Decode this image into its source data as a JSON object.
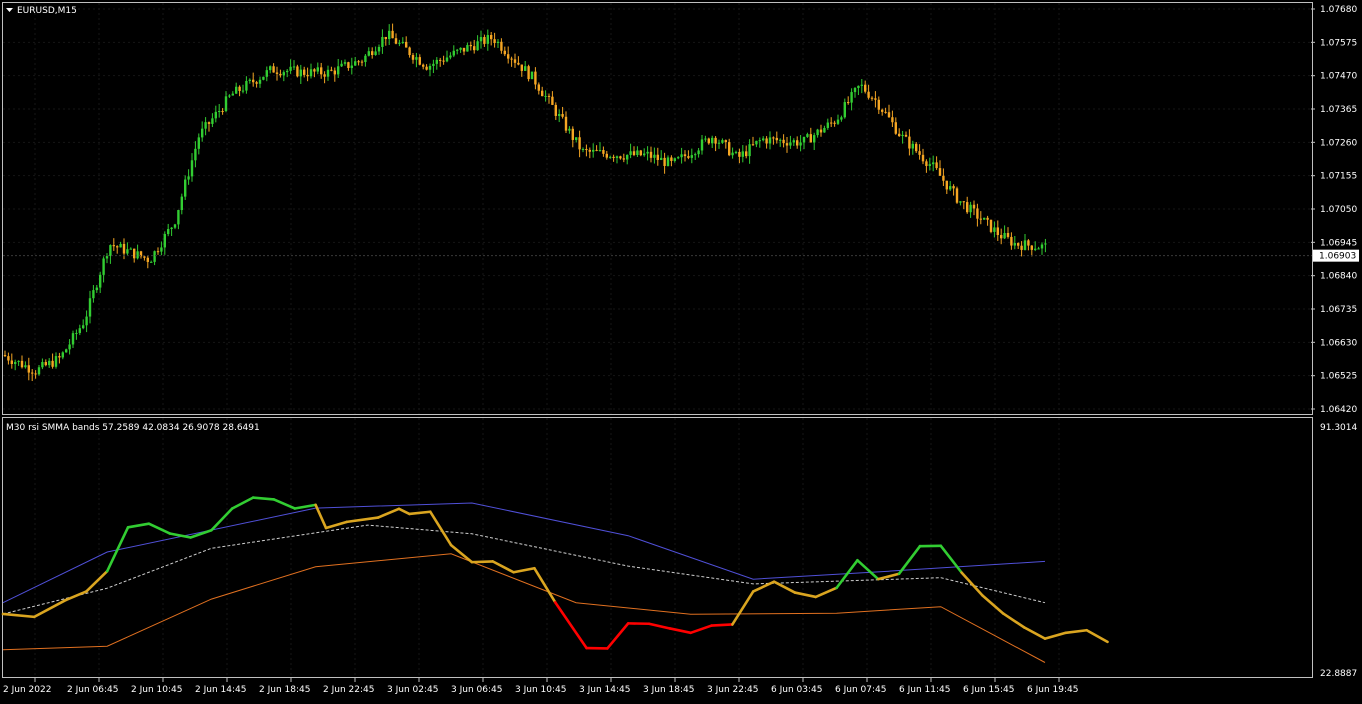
{
  "main_pane": {
    "title": "EURUSD,M15",
    "current_price": "1.06903",
    "price_ticks": [
      "1.07680",
      "1.07575",
      "1.07470",
      "1.07365",
      "1.07260",
      "1.07155",
      "1.07050",
      "1.06945",
      "1.06840",
      "1.06735",
      "1.06630",
      "1.06525",
      "1.06420"
    ]
  },
  "indicator_pane": {
    "title": "M30 rsi SMMA bands 57.2589 42.0834 26.9078 28.6491",
    "max_label": "91.3014",
    "min_label": "22.8887"
  },
  "time_ticks": [
    "2 Jun 2022",
    "2 Jun 06:45",
    "2 Jun 10:45",
    "2 Jun 14:45",
    "2 Jun 18:45",
    "2 Jun 22:45",
    "3 Jun 02:45",
    "3 Jun 06:45",
    "3 Jun 10:45",
    "3 Jun 14:45",
    "3 Jun 18:45",
    "3 Jun 22:45",
    "6 Jun 03:45",
    "6 Jun 07:45",
    "6 Jun 11:45",
    "6 Jun 15:45",
    "6 Jun 19:45"
  ],
  "colors": {
    "background": "#000000",
    "grid": "#161616",
    "frame": "#c0c0c0",
    "bull": "#32cd32",
    "bear": "#f5a623",
    "rsi_up": "#32cd32",
    "rsi_neutral": "#daa520",
    "rsi_down": "#ff0000",
    "band_upper": "#5050d8",
    "band_mid": "#cfcfcf",
    "band_lower": "#e07020"
  },
  "chart_data": [
    {
      "type": "candlestick",
      "symbol": "EURUSD",
      "timeframe": "M15",
      "ylim": [
        1.0642,
        1.0768
      ],
      "close_path": [
        [
          0,
          1.0659
        ],
        [
          0.04,
          1.0654
        ],
        [
          0.07,
          1.0658
        ],
        [
          0.1,
          1.067
        ],
        [
          0.13,
          1.0694
        ],
        [
          0.18,
          1.0689
        ],
        [
          0.21,
          1.0701
        ],
        [
          0.24,
          1.0728
        ],
        [
          0.28,
          1.0741
        ],
        [
          0.33,
          1.0749
        ],
        [
          0.37,
          1.0748
        ],
        [
          0.4,
          1.0748
        ],
        [
          0.44,
          1.0752
        ],
        [
          0.47,
          1.076
        ],
        [
          0.52,
          1.075
        ],
        [
          0.57,
          1.0756
        ],
        [
          0.6,
          1.0759
        ],
        [
          0.65,
          1.0746
        ],
        [
          0.71,
          1.0723
        ],
        [
          0.76,
          1.0722
        ],
        [
          0.79,
          1.0722
        ],
        [
          0.82,
          1.0719
        ],
        [
          0.87,
          1.0728
        ],
        [
          0.9,
          1.0721
        ],
        [
          0.93,
          1.0727
        ],
        [
          0.98,
          1.0726
        ],
        [
          1.02,
          1.0733
        ],
        [
          1.05,
          1.0744
        ],
        [
          1.07,
          1.0739
        ],
        [
          1.1,
          1.0728
        ],
        [
          1.14,
          1.0718
        ],
        [
          1.17,
          1.0708
        ],
        [
          1.22,
          1.0697
        ],
        [
          1.24,
          1.0694
        ],
        [
          1.28,
          1.0693
        ]
      ]
    },
    {
      "type": "line",
      "name": "M30 rsi SMMA bands",
      "ylim": [
        22.8887,
        91.3014
      ],
      "series": [
        {
          "role": "rsi",
          "values": [
            [
              0,
              38.9
            ],
            [
              0.03,
              38.1
            ],
            [
              0.06,
              42.7
            ],
            [
              0.08,
              45.1
            ],
            [
              0.1,
              50.7
            ],
            [
              0.12,
              62.8
            ],
            [
              0.14,
              63.8
            ],
            [
              0.16,
              61.1
            ],
            [
              0.18,
              60.0
            ],
            [
              0.2,
              62.0
            ],
            [
              0.22,
              68.0
            ],
            [
              0.24,
              71.0
            ],
            [
              0.26,
              70.5
            ],
            [
              0.28,
              68.0
            ],
            [
              0.3,
              69.0
            ],
            [
              0.31,
              62.6
            ],
            [
              0.33,
              64.3
            ],
            [
              0.36,
              65.5
            ],
            [
              0.38,
              67.9
            ],
            [
              0.39,
              66.5
            ],
            [
              0.41,
              67.1
            ],
            [
              0.43,
              57.9
            ],
            [
              0.45,
              53.2
            ],
            [
              0.47,
              53.4
            ],
            [
              0.49,
              50.4
            ],
            [
              0.51,
              51.5
            ],
            [
              0.53,
              42.1
            ],
            [
              0.56,
              29.5
            ],
            [
              0.58,
              29.4
            ],
            [
              0.6,
              36.3
            ],
            [
              0.62,
              36.2
            ],
            [
              0.64,
              34.9
            ],
            [
              0.66,
              33.7
            ],
            [
              0.68,
              35.7
            ],
            [
              0.7,
              36.0
            ],
            [
              0.72,
              45.1
            ],
            [
              0.74,
              47.8
            ],
            [
              0.76,
              44.8
            ],
            [
              0.78,
              43.6
            ],
            [
              0.8,
              46.1
            ],
            [
              0.82,
              53.7
            ],
            [
              0.84,
              48.5
            ],
            [
              0.86,
              50.0
            ],
            [
              0.88,
              57.6
            ],
            [
              0.9,
              57.7
            ],
            [
              0.92,
              50.3
            ],
            [
              0.94,
              44.0
            ],
            [
              0.96,
              39.0
            ],
            [
              0.98,
              35.2
            ],
            [
              1.0,
              32.1
            ],
            [
              1.02,
              33.7
            ],
            [
              1.04,
              34.4
            ],
            [
              1.06,
              31.2
            ]
          ]
        },
        {
          "role": "upper",
          "values": [
            [
              0,
              42.0
            ],
            [
              0.1,
              56.0
            ],
            [
              0.3,
              68.1
            ],
            [
              0.45,
              69.5
            ],
            [
              0.6,
              60.5
            ],
            [
              0.72,
              48.5
            ],
            [
              0.85,
              50.7
            ],
            [
              1.0,
              53.4
            ]
          ]
        },
        {
          "role": "middle",
          "values": [
            [
              0,
              38.9
            ],
            [
              0.1,
              46.0
            ],
            [
              0.2,
              57.0
            ],
            [
              0.35,
              63.4
            ],
            [
              0.45,
              61.0
            ],
            [
              0.6,
              52.1
            ],
            [
              0.72,
              47.2
            ],
            [
              0.9,
              48.9
            ],
            [
              1.0,
              42.0
            ]
          ]
        },
        {
          "role": "lower",
          "values": [
            [
              0,
              29.0
            ],
            [
              0.1,
              30.0
            ],
            [
              0.2,
              43.0
            ],
            [
              0.3,
              51.9
            ],
            [
              0.43,
              55.5
            ],
            [
              0.55,
              42.0
            ],
            [
              0.66,
              38.8
            ],
            [
              0.8,
              39.1
            ],
            [
              0.9,
              40.9
            ],
            [
              1.0,
              25.5
            ]
          ]
        }
      ]
    }
  ]
}
